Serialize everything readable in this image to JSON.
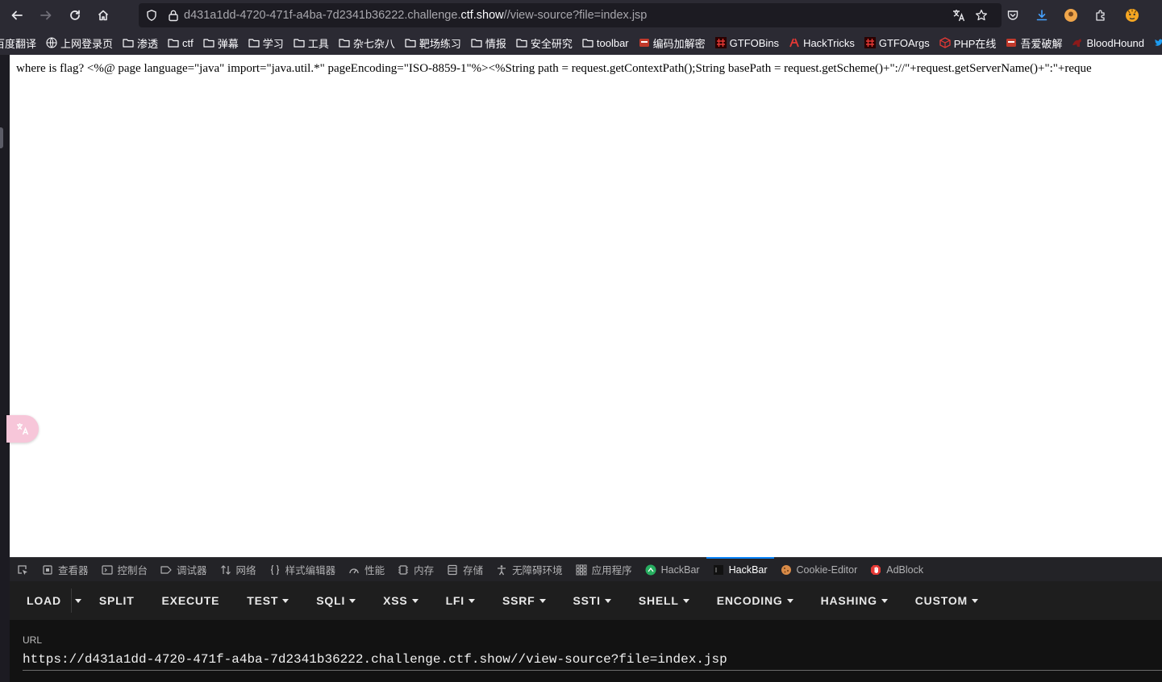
{
  "browser": {
    "url_host_prefix": "d431a1dd-4720-471f-a4ba-7d2341b36222.challenge.",
    "url_host_highlight": "ctf.show",
    "url_path": "//view-source?file=index.jsp"
  },
  "bookmarks": [
    {
      "label": "百度翻译",
      "icon": "none"
    },
    {
      "label": "上网登录页",
      "icon": "globe-icon"
    },
    {
      "label": "渗透",
      "icon": "folder-icon"
    },
    {
      "label": "ctf",
      "icon": "folder-icon"
    },
    {
      "label": "弹幕",
      "icon": "folder-icon"
    },
    {
      "label": "学习",
      "icon": "folder-icon"
    },
    {
      "label": "工具",
      "icon": "folder-icon"
    },
    {
      "label": "杂七杂八",
      "icon": "folder-icon"
    },
    {
      "label": "靶场练习",
      "icon": "folder-icon"
    },
    {
      "label": "情报",
      "icon": "folder-icon"
    },
    {
      "label": "安全研究",
      "icon": "folder-icon"
    },
    {
      "label": "toolbar",
      "icon": "folder-icon"
    },
    {
      "label": "编码加解密",
      "icon": "site-icon"
    },
    {
      "label": "GTFOBins",
      "icon": "hash-icon"
    },
    {
      "label": "HackTricks",
      "icon": "hacktricks-icon"
    },
    {
      "label": "GTFOArgs",
      "icon": "hash-icon"
    },
    {
      "label": "PHP在线",
      "icon": "cube-icon"
    },
    {
      "label": "吾爱破解",
      "icon": "site-icon"
    },
    {
      "label": "BloodHound",
      "icon": "bloodhound-icon"
    }
  ],
  "page": {
    "text": "where is flag? <%@ page language=\"java\" import=\"java.util.*\" pageEncoding=\"ISO-8859-1\"%><%String path = request.getContextPath();String basePath = request.getScheme()+\"://\"+request.getServerName()+\":\"+reque"
  },
  "devtools": {
    "tabs": [
      {
        "label": "查看器",
        "icon": "inspector-icon"
      },
      {
        "label": "控制台",
        "icon": "console-icon"
      },
      {
        "label": "调试器",
        "icon": "debugger-icon"
      },
      {
        "label": "网络",
        "icon": "network-icon"
      },
      {
        "label": "样式编辑器",
        "icon": "style-editor-icon"
      },
      {
        "label": "性能",
        "icon": "performance-icon"
      },
      {
        "label": "内存",
        "icon": "memory-icon"
      },
      {
        "label": "存储",
        "icon": "storage-icon"
      },
      {
        "label": "无障碍环境",
        "icon": "accessibility-icon"
      },
      {
        "label": "应用程序",
        "icon": "application-icon"
      },
      {
        "label": "HackBar",
        "icon": "hackbar-green-icon"
      },
      {
        "label": "HackBar",
        "icon": "hackbar-dark-icon"
      },
      {
        "label": "Cookie-Editor",
        "icon": "cookie-icon"
      },
      {
        "label": "AdBlock",
        "icon": "adblock-icon"
      }
    ],
    "active_tab": 11
  },
  "hackbar": {
    "load_label": "LOAD",
    "split_label": "SPLIT",
    "execute_label": "EXECUTE",
    "menus": [
      "TEST",
      "SQLI",
      "XSS",
      "LFI",
      "SSRF",
      "SSTI",
      "SHELL",
      "ENCODING",
      "HASHING",
      "CUSTOM"
    ],
    "url_label": "URL",
    "url_value": "https://d431a1dd-4720-471f-a4ba-7d2341b36222.challenge.ctf.show//view-source?file=index.jsp"
  },
  "colors": {
    "toolbar_bg": "#2b2a33",
    "urlbar_bg": "#1c1b22",
    "devtools_bg": "#232327",
    "active_tab_accent": "#0a84ff",
    "hackbar_menu_bg": "#1e1e1e",
    "hackbar_body_bg": "#121212"
  }
}
